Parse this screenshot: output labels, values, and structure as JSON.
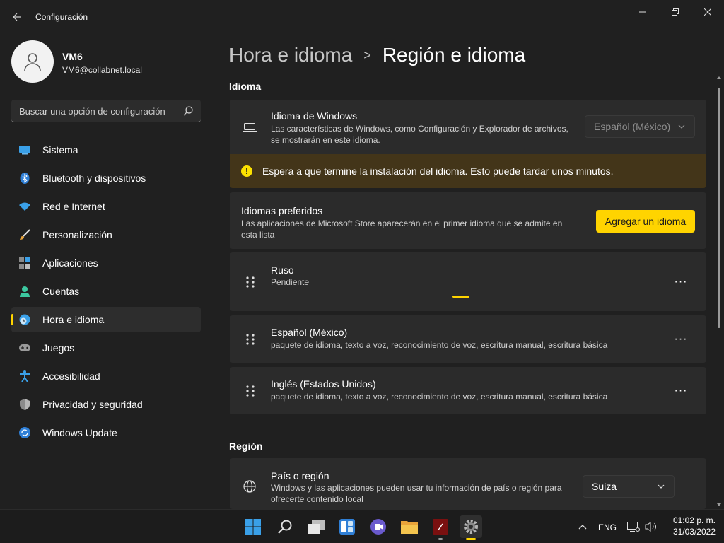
{
  "window": {
    "app_title": "Configuración"
  },
  "profile": {
    "name": "VM6",
    "email": "VM6@collabnet.local"
  },
  "search": {
    "placeholder": "Buscar una opción de configuración"
  },
  "sidebar": {
    "items": [
      {
        "label": "Sistema",
        "icon": "system-icon"
      },
      {
        "label": "Bluetooth y dispositivos",
        "icon": "bluetooth-icon"
      },
      {
        "label": "Red e Internet",
        "icon": "wifi-icon"
      },
      {
        "label": "Personalización",
        "icon": "brush-icon"
      },
      {
        "label": "Aplicaciones",
        "icon": "apps-icon"
      },
      {
        "label": "Cuentas",
        "icon": "accounts-icon"
      },
      {
        "label": "Hora e idioma",
        "icon": "time-language-icon",
        "active": true
      },
      {
        "label": "Juegos",
        "icon": "gamepad-icon"
      },
      {
        "label": "Accesibilidad",
        "icon": "accessibility-icon"
      },
      {
        "label": "Privacidad y seguridad",
        "icon": "shield-icon"
      },
      {
        "label": "Windows Update",
        "icon": "update-icon"
      }
    ]
  },
  "breadcrumb": {
    "parent": "Hora e idioma",
    "separator": ">",
    "current": "Región e idioma"
  },
  "language_section": {
    "title": "Idioma",
    "windows_language": {
      "title": "Idioma de Windows",
      "description_line1": "Las características de Windows, como Configuración y Explorador de archivos,",
      "description_line2": "se mostrarán en este idioma.",
      "selected": "Español (México)"
    },
    "warning": {
      "text": "Espera a que termine la instalación del idioma. Esto puede tardar unos minutos."
    },
    "preferred": {
      "title": "Idiomas preferidos",
      "description_line1": "Las aplicaciones de Microsoft Store aparecerán en el primer idioma que se admite en",
      "description_line2": "esta lista",
      "add_button": "Agregar un idioma"
    },
    "languages": [
      {
        "name": "Ruso",
        "detail": "Pendiente"
      },
      {
        "name": "Español (México)",
        "detail": "paquete de idioma, texto a voz, reconocimiento de voz, escritura manual, escritura básica"
      },
      {
        "name": "Inglés (Estados Unidos)",
        "detail": "paquete de idioma, texto a voz, reconocimiento de voz, escritura manual, escritura básica"
      }
    ],
    "more_label": "···"
  },
  "region_section": {
    "title": "Región",
    "country": {
      "title": "País o región",
      "description_line1": "Windows y las aplicaciones pueden usar tu información de país o región para",
      "description_line2": "ofrecerte contenido local",
      "selected": "Suiza"
    }
  },
  "taskbar": {
    "apps": [
      "start-icon",
      "search-icon",
      "task-view-icon",
      "widgets-icon",
      "chat-icon",
      "file-explorer-icon",
      "app-icon",
      "settings-icon"
    ],
    "language": "ENG",
    "time": "01:02 p. m.",
    "date": "31/03/2022"
  },
  "colors": {
    "background": "#202020",
    "card": "#2b2b2b",
    "accent": "#ffd400",
    "warning_bg": "#433519"
  }
}
